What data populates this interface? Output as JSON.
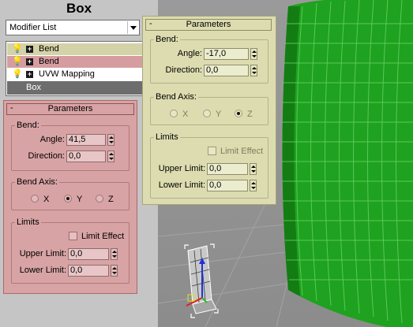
{
  "panel": {
    "title": "Box",
    "modifier_list": {
      "selected": "Modifier List"
    },
    "stack": [
      {
        "label": "Bend"
      },
      {
        "label": "Bend"
      },
      {
        "label": "UVW Mapping"
      },
      {
        "label": "Box"
      }
    ]
  },
  "rollout_active": {
    "header": "Parameters",
    "bend_group": "Bend:",
    "angle_label": "Angle:",
    "angle_value": "41,5",
    "direction_label": "Direction:",
    "direction_value": "0,0",
    "axis_group": "Bend Axis:",
    "axis_x": "X",
    "axis_y": "Y",
    "axis_z": "Z",
    "selected_axis": "Y",
    "limits_group": "Limits",
    "limit_effect": "Limit Effect",
    "limit_effect_checked": false,
    "upper_label": "Upper Limit:",
    "upper_value": "0,0",
    "lower_label": "Lower Limit:",
    "lower_value": "0,0"
  },
  "rollout_floating": {
    "header": "Parameters",
    "bend_group": "Bend:",
    "angle_label": "Angle:",
    "angle_value": "-17,0",
    "direction_label": "Direction:",
    "direction_value": "0,0",
    "axis_group": "Bend Axis:",
    "axis_x": "X",
    "axis_y": "Y",
    "axis_z": "Z",
    "selected_axis": "Z",
    "limits_group": "Limits",
    "limit_effect": "Limit Effect",
    "limit_effect_checked": false,
    "upper_label": "Upper Limit:",
    "upper_value": "0,0",
    "lower_label": "Lower Limit:",
    "lower_value": "0,0"
  },
  "colors": {
    "active_rollout": "#d8a3a4",
    "floating_rollout": "#dcdcb0",
    "mesh_green": "#1fa21f",
    "viewport": "#939393"
  },
  "icons": [
    "lightbulb-icon",
    "expand-plus-icon",
    "dropdown-arrow-icon",
    "spinner-arrows-icon",
    "transform-gizmo-icon"
  ]
}
